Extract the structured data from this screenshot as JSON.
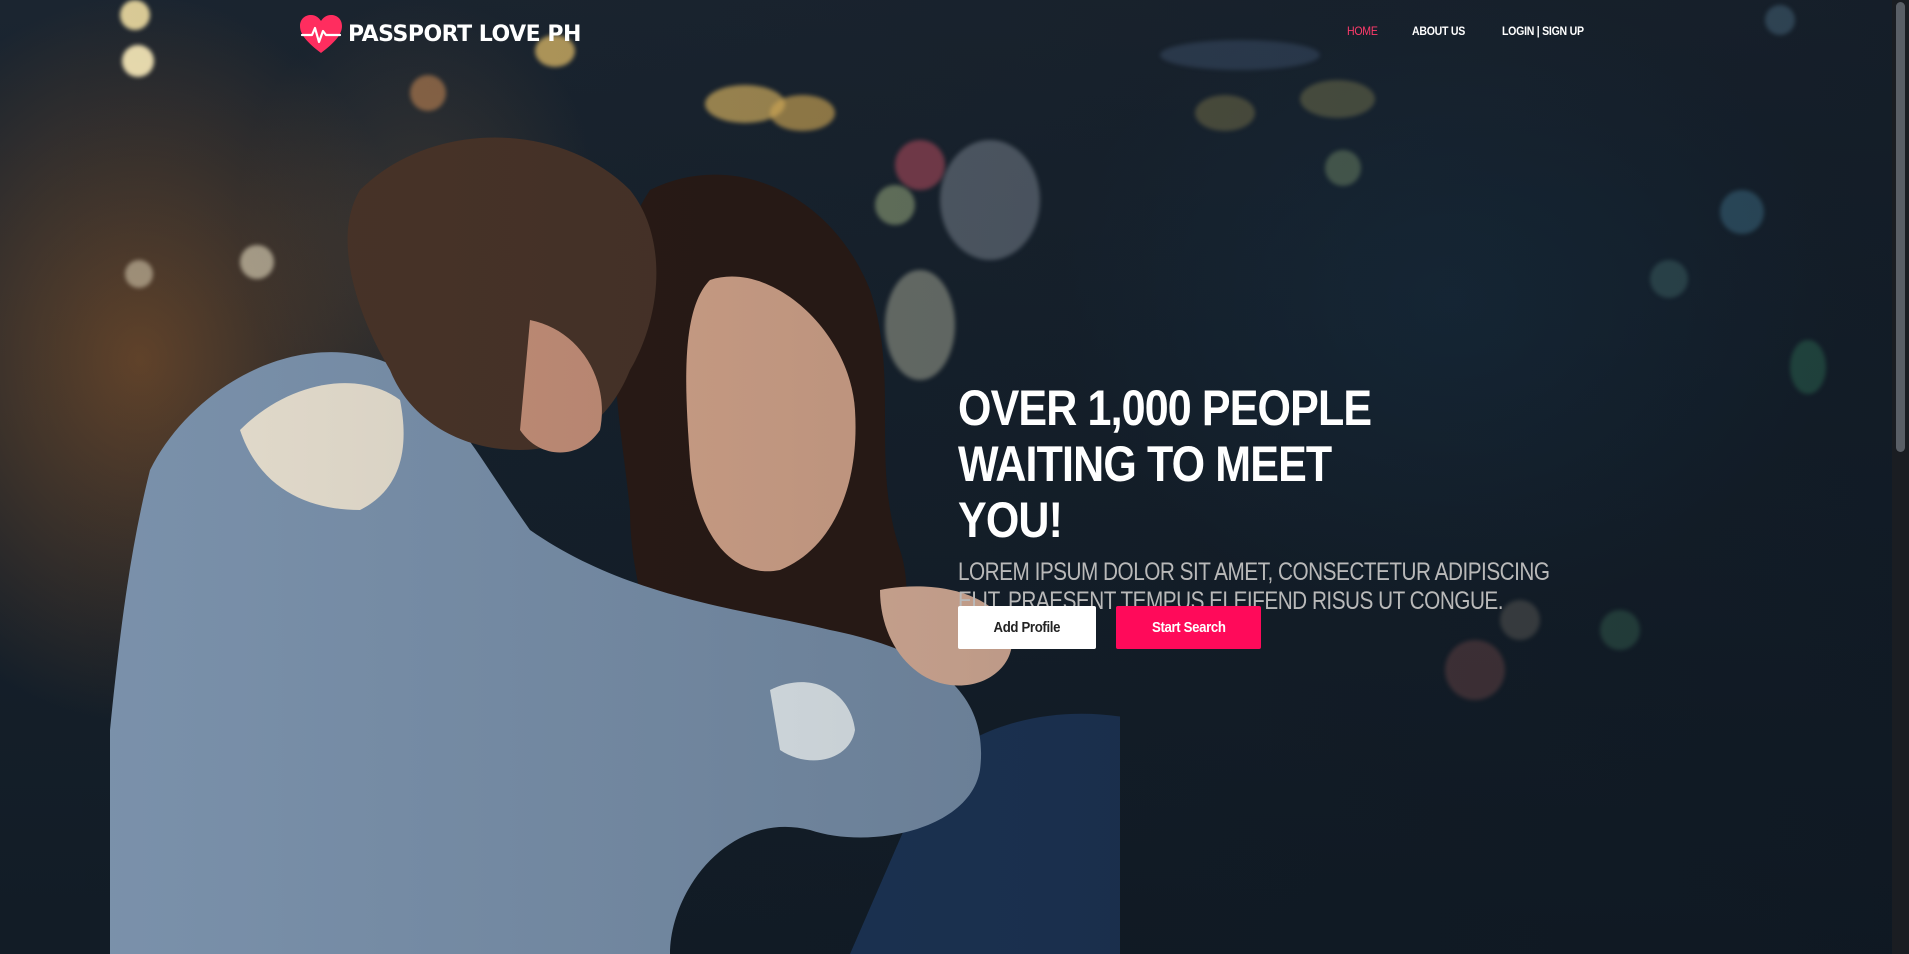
{
  "brand": {
    "name": "PASSPORT LOVE PH",
    "heart_color": "#ff2d5f"
  },
  "nav": {
    "items": [
      {
        "label": "HOME",
        "active": true
      },
      {
        "label": "ABOUT US",
        "active": false
      },
      {
        "label": "LOGIN | SIGN UP",
        "active": false
      }
    ]
  },
  "hero": {
    "title": "OVER 1,000 PEOPLE WAITING TO MEET YOU!",
    "subtitle": "LOREM IPSUM DOLOR SIT AMET, CONSECTETUR ADIPISCING ELIT. PRAESENT TEMPUS ELEIFEND RISUS UT CONGUE.",
    "buttons": {
      "add_profile": "Add Profile",
      "start_search": "Start Search"
    }
  },
  "colors": {
    "accent": "#ff0a5a",
    "nav_active": "#ff3b6b"
  },
  "icons": {
    "logo": "heart-pulse-icon"
  }
}
